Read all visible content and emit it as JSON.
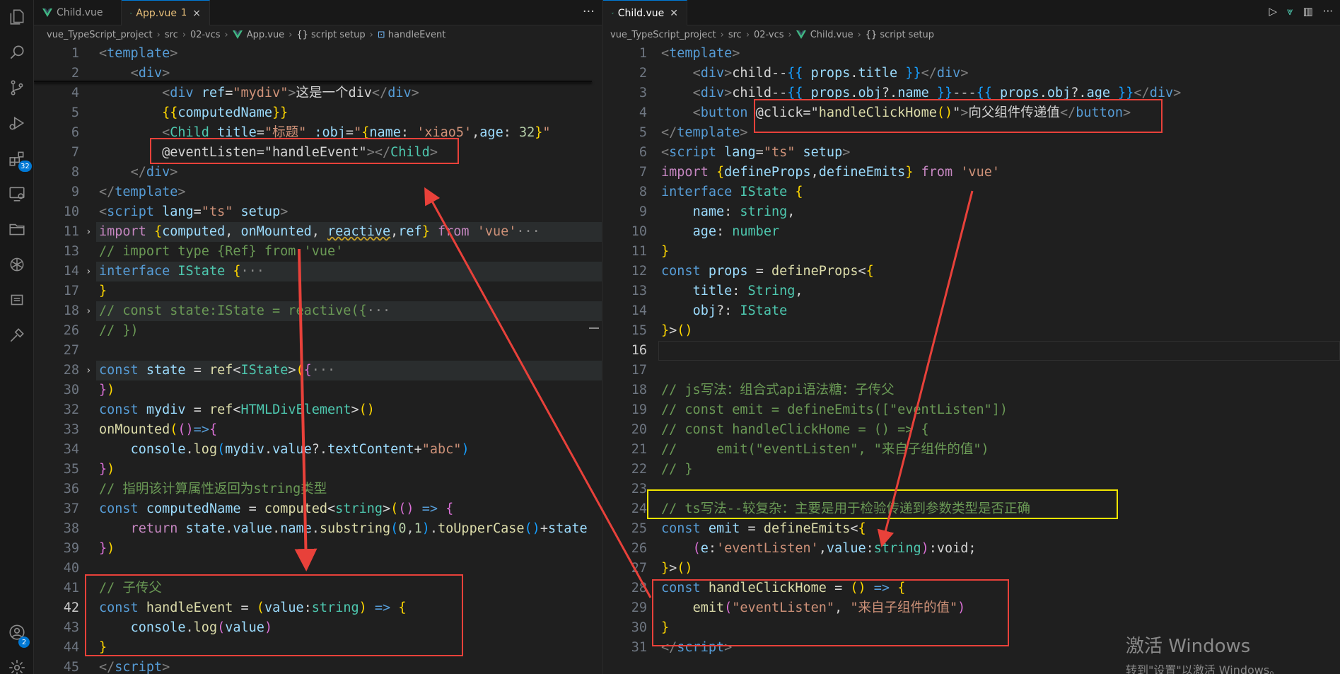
{
  "activity_bar": [
    {
      "icon": "explorer-icon"
    },
    {
      "icon": "search-icon"
    },
    {
      "icon": "source-control-icon"
    },
    {
      "icon": "run-debug-icon"
    },
    {
      "icon": "extensions-icon",
      "badge": "32"
    },
    {
      "icon": "remote-explorer-icon"
    },
    {
      "icon": "folder-icon"
    },
    {
      "icon": "openai-icon"
    },
    {
      "icon": "output-icon"
    },
    {
      "icon": "tools-icon"
    },
    {
      "icon": "account-icon",
      "badge": "2"
    },
    {
      "icon": "settings-gear-icon"
    }
  ],
  "left_pane": {
    "tabs": [
      {
        "label": "Child.vue",
        "active": false
      },
      {
        "label": "App.vue",
        "active": true,
        "modified": "1",
        "close": "×"
      }
    ],
    "more": "···",
    "breadcrumb": [
      "vue_TypeScript_project",
      "src",
      "02-vcs",
      "App.vue",
      "script setup",
      "handleEvent"
    ],
    "lines": [
      {
        "n": "1",
        "html": "<span class=\"t-tag\">&lt;</span><span class=\"t-name\">template</span><span class=\"t-tag\">&gt;</span>"
      },
      {
        "n": "2",
        "html": "    <span class=\"t-tag\">&lt;</span><span class=\"t-name\">div</span><span class=\"t-tag\">&gt;</span>"
      },
      {
        "n": "4",
        "html": "        <span class=\"t-tag\">&lt;</span><span class=\"t-name\">div</span> <span class=\"t-attr\">ref</span><span class=\"t-plain\">=</span><span class=\"t-str\">\"mydiv\"</span><span class=\"t-tag\">&gt;</span><span class=\"t-plain\">这是一个div</span><span class=\"t-tag\">&lt;/</span><span class=\"t-name\">div</span><span class=\"t-tag\">&gt;</span>"
      },
      {
        "n": "5",
        "html": "        <span class=\"t-br1\">{{</span><span class=\"t-var\">computedName</span><span class=\"t-br1\">}}</span>"
      },
      {
        "n": "6",
        "html": "        <span class=\"t-tag\">&lt;</span><span class=\"t-type\">Child</span> <span class=\"t-attr\">title</span><span class=\"t-plain\">=</span><span class=\"t-str\">\"标题\"</span> <span class=\"t-attr\">:obj</span><span class=\"t-plain\">=</span><span class=\"t-str\">\"</span><span class=\"t-br1\">{</span><span class=\"t-var\">name</span><span class=\"t-plain\">: </span><span class=\"t-str\">'xiao5'</span><span class=\"t-plain\">,</span><span class=\"t-var\">age</span><span class=\"t-plain\">: </span><span class=\"t-num\">32</span><span class=\"t-br1\">}</span><span class=\"t-str\">\"</span>"
      },
      {
        "n": "7",
        "html": "        <span class=\"t-plain\">@eventListen=\"handleEvent\"</span><span class=\"t-tag\">&gt;&lt;/</span><span class=\"t-type\">Child</span><span class=\"t-tag\">&gt;</span>"
      },
      {
        "n": "8",
        "html": "    <span class=\"t-tag\">&lt;/</span><span class=\"t-name\">div</span><span class=\"t-tag\">&gt;</span>"
      },
      {
        "n": "9",
        "html": "<span class=\"t-tag\">&lt;/</span><span class=\"t-name\">template</span><span class=\"t-tag\">&gt;</span>"
      },
      {
        "n": "10",
        "html": "<span class=\"t-tag\">&lt;</span><span class=\"t-name\">script</span> <span class=\"t-attr\">lang</span><span class=\"t-plain\">=</span><span class=\"t-str\">\"ts\"</span> <span class=\"t-attr\">setup</span><span class=\"t-tag\">&gt;</span>"
      },
      {
        "n": "11",
        "fold": true,
        "hl": true,
        "html": "<span class=\"t-ctrl\">import</span> <span class=\"t-br1\">{</span><span class=\"t-var\">computed</span><span class=\"t-plain\">, </span><span class=\"t-var\">onMounted</span><span class=\"t-plain\">, </span><span class=\"t-var\" style=\"text-decoration: underline wavy #c9a227;\">reactive</span><span class=\"t-plain\">,</span><span class=\"t-var\">ref</span><span class=\"t-br1\">}</span> <span class=\"t-ctrl\">from</span> <span class=\"t-str\">'vue'</span><span class=\"t-ellip\">···</span>"
      },
      {
        "n": "13",
        "html": "<span class=\"t-com\">// import type {Ref} from 'vue'</span>"
      },
      {
        "n": "14",
        "fold": true,
        "hl": true,
        "html": "<span class=\"t-kw\">interface</span> <span class=\"t-type\">IState</span> <span class=\"t-br1\">{</span><span class=\"t-ellip\">···</span>"
      },
      {
        "n": "17",
        "html": "<span class=\"t-br1\">}</span>"
      },
      {
        "n": "18",
        "fold": true,
        "hl": true,
        "html": "<span class=\"t-com\">// const state:IState = reactive({</span><span class=\"t-ellip\">···</span>"
      },
      {
        "n": "26",
        "html": "<span class=\"t-com\">// })</span>"
      },
      {
        "n": "27",
        "html": ""
      },
      {
        "n": "28",
        "fold": true,
        "hl": true,
        "html": "<span class=\"t-kw\">const</span> <span class=\"t-var\">state</span> <span class=\"t-plain\">= </span><span class=\"t-fn\">ref</span><span class=\"t-plain\">&lt;</span><span class=\"t-type\">IState</span><span class=\"t-plain\">&gt;</span><span class=\"t-br1\">(</span><span class=\"t-br2\">{</span><span class=\"t-ellip\">···</span>"
      },
      {
        "n": "30",
        "html": "<span class=\"t-br2\">}</span><span class=\"t-br1\">)</span>"
      },
      {
        "n": "32",
        "html": "<span class=\"t-kw\">const</span> <span class=\"t-var\">mydiv</span> <span class=\"t-plain\">= </span><span class=\"t-fn\">ref</span><span class=\"t-plain\">&lt;</span><span class=\"t-type\">HTMLDivElement</span><span class=\"t-plain\">&gt;</span><span class=\"t-br1\">()</span>"
      },
      {
        "n": "33",
        "html": "<span class=\"t-fn\">onMounted</span><span class=\"t-br1\">(</span><span class=\"t-br2\">()</span><span class=\"t-kw\">=&gt;</span><span class=\"t-br2\">{</span>"
      },
      {
        "n": "34",
        "html": "    <span class=\"t-var\">console</span><span class=\"t-plain\">.</span><span class=\"t-fn\">log</span><span class=\"t-br3\">(</span><span class=\"t-var\">mydiv</span><span class=\"t-plain\">.</span><span class=\"t-var\">value</span><span class=\"t-plain\">?.</span><span class=\"t-var\">textContent</span><span class=\"t-plain\">+</span><span class=\"t-str\">\"abc\"</span><span class=\"t-br3\">)</span>"
      },
      {
        "n": "35",
        "html": "<span class=\"t-br2\">}</span><span class=\"t-br1\">)</span>"
      },
      {
        "n": "36",
        "html": "<span class=\"t-com\">// 指明该计算属性返回为string类型</span>"
      },
      {
        "n": "37",
        "html": "<span class=\"t-kw\">const</span> <span class=\"t-var\">computedName</span> <span class=\"t-plain\">= </span><span class=\"t-fn\">computed</span><span class=\"t-plain\">&lt;</span><span class=\"t-type\">string</span><span class=\"t-plain\">&gt;</span><span class=\"t-br1\">(</span><span class=\"t-br2\">()</span> <span class=\"t-kw\">=&gt;</span> <span class=\"t-br2\">{</span>"
      },
      {
        "n": "38",
        "html": "    <span class=\"t-ctrl\">return</span> <span class=\"t-var\">state</span><span class=\"t-plain\">.</span><span class=\"t-var\">value</span><span class=\"t-plain\">.</span><span class=\"t-var\">name</span><span class=\"t-plain\">.</span><span class=\"t-fn\">substring</span><span class=\"t-br3\">(</span><span class=\"t-num\">0</span><span class=\"t-plain\">,</span><span class=\"t-num\">1</span><span class=\"t-br3\">)</span><span class=\"t-plain\">.</span><span class=\"t-fn\">toUpperCase</span><span class=\"t-br3\">()</span><span class=\"t-plain\">+</span><span class=\"t-var\">state</span>"
      },
      {
        "n": "39",
        "html": "<span class=\"t-br2\">}</span><span class=\"t-br1\">)</span>"
      },
      {
        "n": "40",
        "html": ""
      },
      {
        "n": "41",
        "html": "<span class=\"t-com\">// 子传父</span>"
      },
      {
        "n": "42",
        "cur": true,
        "html": "<span class=\"t-kw\">const</span> <span class=\"t-fn\">handleEvent</span> <span class=\"t-plain\">= </span><span class=\"t-br1\">(</span><span class=\"t-var\">value</span><span class=\"t-plain\">:</span><span class=\"t-type\">string</span><span class=\"t-br1\">)</span> <span class=\"t-kw\">=&gt;</span> <span class=\"t-br1\">{</span>"
      },
      {
        "n": "43",
        "html": "    <span class=\"t-var\">console</span><span class=\"t-plain\">.</span><span class=\"t-fn\">log</span><span class=\"t-br2\">(</span><span class=\"t-var\">value</span><span class=\"t-br2\">)</span>"
      },
      {
        "n": "44",
        "html": "<span class=\"t-br1\">}</span>"
      },
      {
        "n": "45",
        "html": "<span class=\"t-tag\">&lt;/</span><span class=\"t-name\">script</span><span class=\"t-tag\">&gt;</span>"
      }
    ]
  },
  "right_pane": {
    "tabs": [
      {
        "label": "Child.vue",
        "active": true,
        "close": "✕"
      }
    ],
    "breadcrumb": [
      "vue_TypeScript_project",
      "src",
      "02-vcs",
      "Child.vue",
      "script setup"
    ],
    "lines": [
      {
        "n": "1",
        "html": "<span class=\"t-tag\">&lt;</span><span class=\"t-name\">template</span><span class=\"t-tag\">&gt;</span>"
      },
      {
        "n": "2",
        "html": "    <span class=\"t-tag\">&lt;</span><span class=\"t-name\">div</span><span class=\"t-tag\">&gt;</span><span class=\"t-plain\">child--</span><span class=\"t-br3\">{{</span> <span class=\"t-var\">props</span><span class=\"t-plain\">.</span><span class=\"t-var\">title</span> <span class=\"t-br3\">}}</span><span class=\"t-tag\">&lt;/</span><span class=\"t-name\">div</span><span class=\"t-tag\">&gt;</span>"
      },
      {
        "n": "3",
        "html": "    <span class=\"t-tag\">&lt;</span><span class=\"t-name\">div</span><span class=\"t-tag\">&gt;</span><span class=\"t-plain\">child--</span><span class=\"t-br3\">{{</span> <span class=\"t-var\">props</span><span class=\"t-plain\">.</span><span class=\"t-var\">obj</span><span class=\"t-plain\">?.</span><span class=\"t-var\">name</span> <span class=\"t-br3\">}}</span><span class=\"t-plain\">---</span><span class=\"t-br3\">{{</span> <span class=\"t-var\">props</span><span class=\"t-plain\">.</span><span class=\"t-var\">obj</span><span class=\"t-plain\">?.</span><span class=\"t-var\">age</span> <span class=\"t-br3\">}}</span><span class=\"t-tag\">&lt;/</span><span class=\"t-name\">div</span><span class=\"t-tag\">&gt;</span>"
      },
      {
        "n": "4",
        "html": "    <span class=\"t-tag\">&lt;</span><span class=\"t-name\">button</span> <span class=\"t-plain\">@click=\"</span><span class=\"t-fn\">handleClickHome</span><span class=\"t-br1\">()</span><span class=\"t-plain\">\"</span><span class=\"t-tag\">&gt;</span><span class=\"t-plain\">向父组件传递值</span><span class=\"t-tag\">&lt;/</span><span class=\"t-name\">button</span><span class=\"t-tag\">&gt;</span>"
      },
      {
        "n": "5",
        "html": "<span class=\"t-tag\">&lt;/</span><span class=\"t-name\">template</span><span class=\"t-tag\">&gt;</span>"
      },
      {
        "n": "6",
        "html": "<span class=\"t-tag\">&lt;</span><span class=\"t-name\">script</span> <span class=\"t-attr\">lang</span><span class=\"t-plain\">=</span><span class=\"t-str\">\"ts\"</span> <span class=\"t-attr\">setup</span><span class=\"t-tag\">&gt;</span>"
      },
      {
        "n": "7",
        "html": "<span class=\"t-ctrl\">import</span> <span class=\"t-br1\">{</span><span class=\"t-var\">defineProps</span><span class=\"t-plain\">,</span><span class=\"t-var\">defineEmits</span><span class=\"t-br1\">}</span> <span class=\"t-ctrl\">from</span> <span class=\"t-str\">'vue'</span>"
      },
      {
        "n": "8",
        "html": "<span class=\"t-kw\">interface</span> <span class=\"t-type\">IState</span> <span class=\"t-br1\">{</span>"
      },
      {
        "n": "9",
        "html": "    <span class=\"t-var\">name</span><span class=\"t-plain\">: </span><span class=\"t-type\">string</span><span class=\"t-plain\">,</span>"
      },
      {
        "n": "10",
        "html": "    <span class=\"t-var\">age</span><span class=\"t-plain\">: </span><span class=\"t-type\">number</span>"
      },
      {
        "n": "11",
        "html": "<span class=\"t-br1\">}</span>"
      },
      {
        "n": "12",
        "html": "<span class=\"t-kw\">const</span> <span class=\"t-var\">props</span> <span class=\"t-plain\">= </span><span class=\"t-fn\">defineProps</span><span class=\"t-plain\">&lt;</span><span class=\"t-br1\">{</span>"
      },
      {
        "n": "13",
        "html": "    <span class=\"t-var\">title</span><span class=\"t-plain\">: </span><span class=\"t-type\">String</span><span class=\"t-plain\">,</span>"
      },
      {
        "n": "14",
        "html": "    <span class=\"t-var\">obj</span><span class=\"t-plain\">?: </span><span class=\"t-type\">IState</span>"
      },
      {
        "n": "15",
        "html": "<span class=\"t-br1\">}</span><span class=\"t-plain\">&gt;</span><span class=\"t-br1\">()</span>"
      },
      {
        "n": "16",
        "cur": true,
        "html": ""
      },
      {
        "n": "17",
        "html": ""
      },
      {
        "n": "18",
        "html": "<span class=\"t-com\">// js写法：组合式api语法糖：子传父</span>"
      },
      {
        "n": "19",
        "html": "<span class=\"t-com\">// const emit = defineEmits([\"eventListen\"])</span>"
      },
      {
        "n": "20",
        "html": "<span class=\"t-com\">// const handleClickHome = () =&gt; {</span>"
      },
      {
        "n": "21",
        "html": "<span class=\"t-com\">//     emit(\"eventListen\", \"来自子组件的值\")</span>"
      },
      {
        "n": "22",
        "html": "<span class=\"t-com\">// }</span>"
      },
      {
        "n": "23",
        "html": ""
      },
      {
        "n": "24",
        "html": "<span class=\"t-com\">// ts写法--较复杂：主要是用于检验传递到参数类型是否正确</span>"
      },
      {
        "n": "25",
        "html": "<span class=\"t-kw\">const</span> <span class=\"t-var\">emit</span> <span class=\"t-plain\">= </span><span class=\"t-fn\">defineEmits</span><span class=\"t-plain\">&lt;</span><span class=\"t-br1\">{</span>"
      },
      {
        "n": "26",
        "html": "    <span class=\"t-br2\">(</span><span class=\"t-var\">e</span><span class=\"t-plain\">:</span><span class=\"t-str\">'eventListen'</span><span class=\"t-plain\">,</span><span class=\"t-var\">value</span><span class=\"t-plain\">:</span><span class=\"t-type\">string</span><span class=\"t-br2\">)</span><span class=\"t-plain\">:void;</span>"
      },
      {
        "n": "27",
        "html": "<span class=\"t-br1\">}</span><span class=\"t-plain\">&gt;</span><span class=\"t-br1\">()</span>"
      },
      {
        "n": "28",
        "html": "<span class=\"t-kw\">const</span> <span class=\"t-fn\">handleClickHome</span> <span class=\"t-plain\">= </span><span class=\"t-br1\">()</span> <span class=\"t-kw\">=&gt;</span> <span class=\"t-br1\">{</span>"
      },
      {
        "n": "29",
        "html": "    <span class=\"t-fn\">emit</span><span class=\"t-br2\">(</span><span class=\"t-str\">\"eventListen\"</span><span class=\"t-plain\">, </span><span class=\"t-str\">\"来自子组件的值\"</span><span class=\"t-br2\">)</span>"
      },
      {
        "n": "30",
        "html": "<span class=\"t-br1\">}</span>"
      },
      {
        "n": "31",
        "html": "<span class=\"t-tag\">&lt;/</span><span class=\"t-name\">script</span><span class=\"t-tag\">&gt;</span>"
      }
    ]
  },
  "watermark": {
    "line1": "激活 Windows",
    "line2": "转到\"设置\"以激活 Windows。"
  },
  "colors": {
    "annotation_red": "#e8413a",
    "annotation_yellow": "#f2e600",
    "editor_bg": "#1f1f1f"
  }
}
